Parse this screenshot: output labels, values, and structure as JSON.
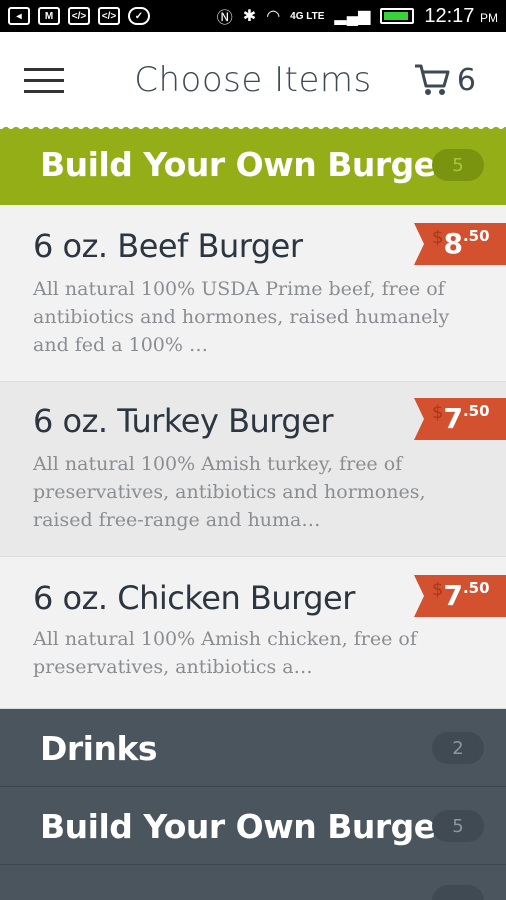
{
  "status_bar": {
    "time": "12:17",
    "ampm": "PM",
    "network": "4G LTE"
  },
  "header": {
    "title": "Choose Items",
    "cart_count": "6"
  },
  "active_category": {
    "title": "Build Your Own Burger",
    "count": "5"
  },
  "items": [
    {
      "name": "6 oz. Beef Burger",
      "description": "All natural 100% USDA Prime beef, free of antibiotics and hormones, raised humanely and fed a 100% …",
      "currency": "$",
      "price_dollars": "8",
      "price_cents": ".50"
    },
    {
      "name": "6 oz. Turkey Burger",
      "description": "All natural 100% Amish turkey, free of preservatives, antibiotics and hormones, raised free-range and huma…",
      "currency": "$",
      "price_dollars": "7",
      "price_cents": ".50"
    },
    {
      "name": "6 oz. Chicken Burger",
      "description": "All natural 100% Amish chicken, free of preservatives, antibiotics a…",
      "currency": "$",
      "price_dollars": "7",
      "price_cents": ".50"
    }
  ],
  "categories": [
    {
      "title": "Drinks",
      "count": "2"
    },
    {
      "title": "Build Your Own Burger",
      "count": "5"
    }
  ],
  "colors": {
    "accent_green": "#94ae18",
    "price_red": "#d4512f",
    "dark_slate": "#4a555e"
  }
}
